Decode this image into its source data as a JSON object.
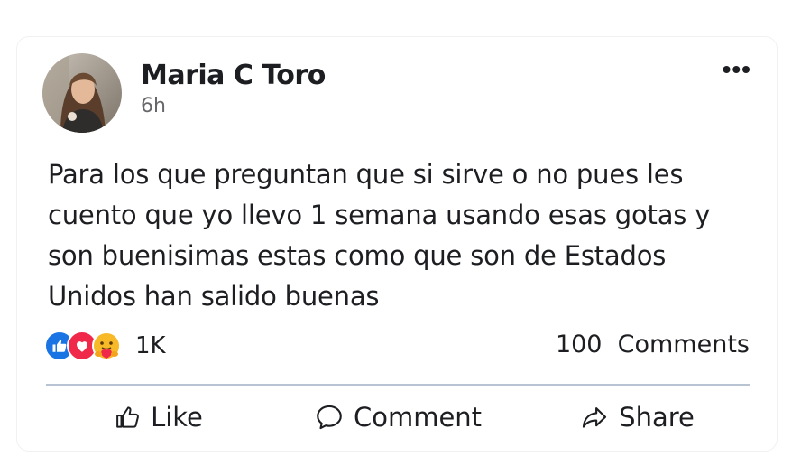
{
  "post": {
    "author": "Maria C Toro",
    "time": "6h",
    "more_label": "•••",
    "text": "Para los que preguntan que si sirve o no pues les cuento que yo llevo 1 semana usando esas gotas y son buenisimas estas como que son de Estados Unidos han salido buenas"
  },
  "reactions": {
    "icons": [
      "like-reaction-icon",
      "love-reaction-icon",
      "care-reaction-icon"
    ],
    "count": "1K"
  },
  "comments": {
    "count_label": "100  Comments"
  },
  "actions": {
    "like": "Like",
    "comment": "Comment",
    "share": "Share"
  },
  "colors": {
    "like_blue": "#1b74e4",
    "love_red": "#f0284a",
    "care_yellow": "#f7b928",
    "divider": "#b8c3d4",
    "secondary_text": "#65676b"
  }
}
